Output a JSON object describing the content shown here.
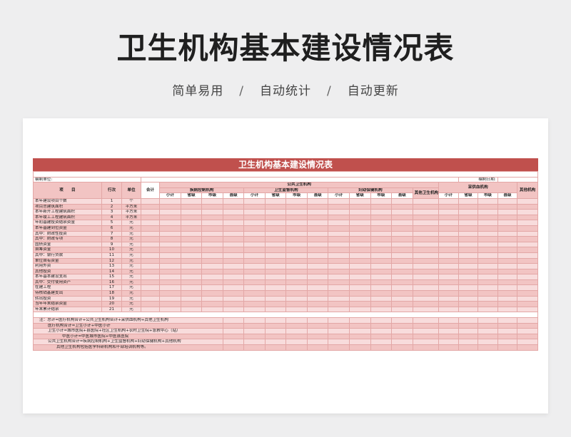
{
  "page_title": "卫生机构基本建设情况表",
  "tags": [
    "简单易用",
    "自动统计",
    "自动更新"
  ],
  "tag_separator": "/",
  "sheet": {
    "title": "卫生机构基本建设情况表",
    "unit_label": "编制单位:",
    "date_label": "编制日期:",
    "headers": {
      "item": "项　　目",
      "seq": "行次",
      "unit": "单位",
      "total": "合计",
      "public_health": "公共卫生机构",
      "disease_control": "疾病控制机构",
      "health_supervision": "卫生监督机构",
      "maternal_child": "妇幼保健机构",
      "other_public": "其他卫生机构",
      "blood_supply": "采供血机构",
      "other": "其他机构",
      "sub": [
        "小计",
        "省级",
        "市级",
        "县级"
      ]
    },
    "rows": [
      {
        "label": "本年建设项目个数",
        "seq": "1",
        "unit": "个"
      },
      {
        "label": "项目总建筑面积",
        "seq": "2",
        "unit": "平方米"
      },
      {
        "label": "本年新开工程建筑面积",
        "seq": "3",
        "unit": "平方米"
      },
      {
        "label": "本年竣工工程建筑面积",
        "seq": "4",
        "unit": "平方米"
      },
      {
        "label": "年初基建投资结余资金",
        "seq": "5",
        "unit": "元"
      },
      {
        "label": "本年基建到位资金",
        "seq": "6",
        "unit": "元"
      },
      {
        "label": "其中：财政性投资",
        "seq": "7",
        "unit": "元"
      },
      {
        "label": "其中：财政专项",
        "seq": "8",
        "unit": "元"
      },
      {
        "label": "国债资金",
        "seq": "9",
        "unit": "元"
      },
      {
        "label": "自筹资金",
        "seq": "10",
        "unit": "元"
      },
      {
        "label": "其中：银行贷款",
        "seq": "11",
        "unit": "元"
      },
      {
        "label": "单位自有资金",
        "seq": "12",
        "unit": "元"
      },
      {
        "label": "利用外资",
        "seq": "13",
        "unit": "元"
      },
      {
        "label": "其他投资",
        "seq": "14",
        "unit": "元"
      },
      {
        "label": "本年基本建设支出",
        "seq": "15",
        "unit": "元"
      },
      {
        "label": "其中：交付使用资产",
        "seq": "16",
        "unit": "元"
      },
      {
        "label": "在建工程",
        "seq": "17",
        "unit": "元"
      },
      {
        "label": "待核销基建支出",
        "seq": "18",
        "unit": "元"
      },
      {
        "label": "转出投资",
        "seq": "19",
        "unit": "元"
      },
      {
        "label": "当年年末结余资金",
        "seq": "20",
        "unit": "元"
      },
      {
        "label": "年末累计结余",
        "seq": "21",
        "unit": "元"
      }
    ],
    "notes": [
      "注：总计=医疗机构合计+公共卫生机构合计+采供血机构+其他卫生机构",
      "医疗机构合计=卫生小计+中医小计",
      "卫生小计=城市医院+县医院+社区卫生机构+农村卫生院+急救中心（站）",
      "中医小计=中医城市医院+中医县医院",
      "公共卫生机构合计=疾病控制机构+卫生监督机构+妇幼保健机构+其他机构",
      "其他卫生机构包括医学科研机构和干部培训机构等。"
    ]
  }
}
